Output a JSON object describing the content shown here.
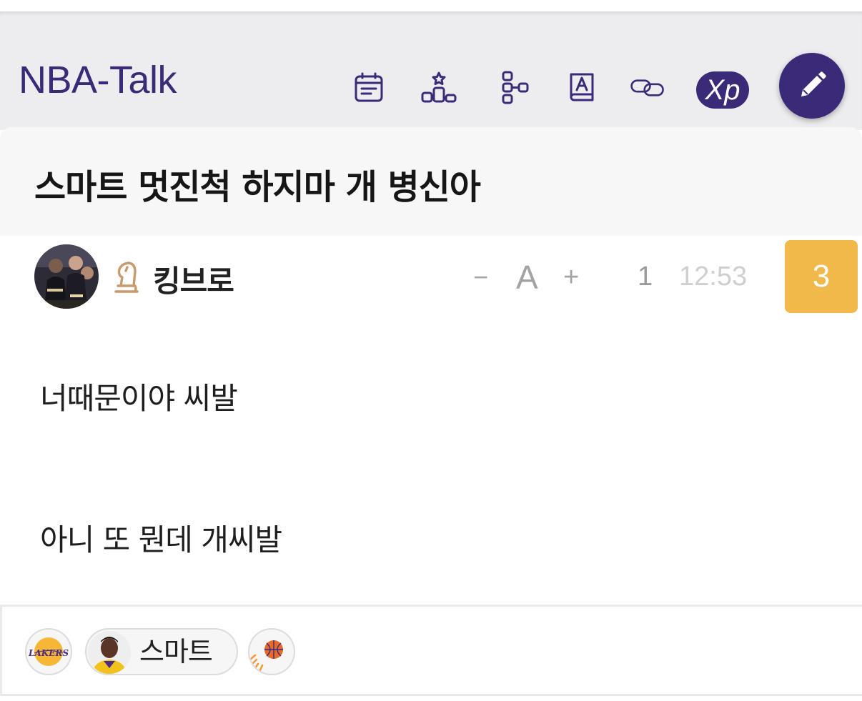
{
  "header": {
    "app_title": "NBA-Talk",
    "icons": [
      "calendar-icon",
      "ranking-icon",
      "bracket-icon",
      "dictionary-icon",
      "link-icon"
    ],
    "xp_label": "Xp",
    "write_icon": "pencil-icon",
    "accent_color": "#3b2a78"
  },
  "post": {
    "title": "스마트 멋진척 하지마 개 병신아",
    "author": "킹브로",
    "rank_icon": "chess-knight-icon",
    "font_controls": {
      "decrease": "−",
      "size": "A",
      "increase": "+"
    },
    "views": "1",
    "time": "12:53",
    "comment_count": "3",
    "comment_badge_color": "#f0b94a",
    "body": [
      "너때문이야 씨발",
      "아니 또 뭔데 개씨발"
    ]
  },
  "tags": {
    "team_logo": "lakers-logo",
    "logo_text": "LAKERS",
    "player_label": "스마트",
    "team2_logo": "suns-logo"
  }
}
